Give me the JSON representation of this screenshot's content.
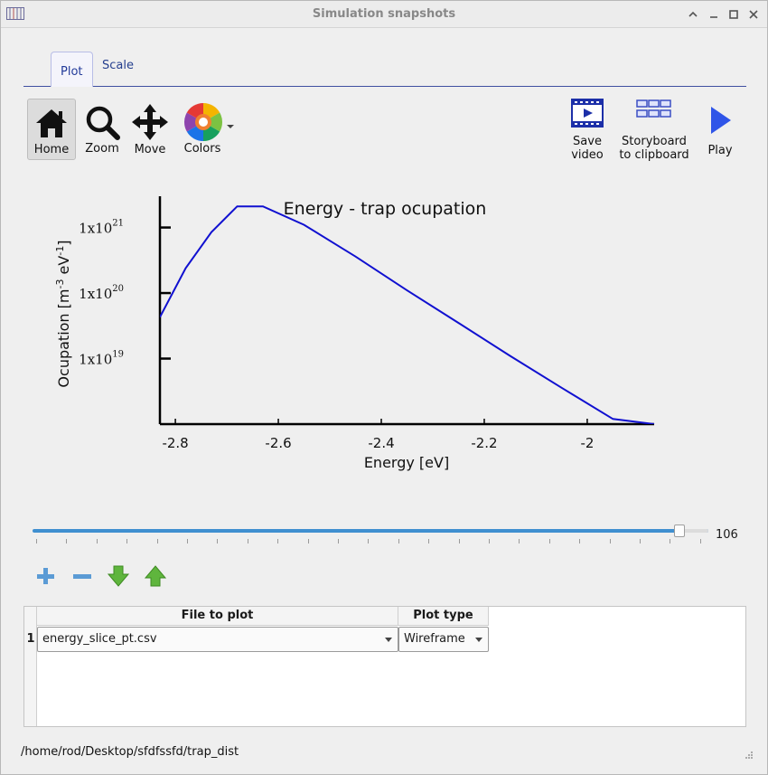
{
  "window": {
    "title": "Simulation snapshots"
  },
  "tabs": [
    {
      "label": "Plot"
    },
    {
      "label": "Scale"
    }
  ],
  "toolbar": {
    "home": "Home",
    "zoom": "Zoom",
    "move": "Move",
    "colors": "Colors",
    "save_video": [
      "Save",
      "video"
    ],
    "storyboard": [
      "Storyboard",
      "to clipboard"
    ],
    "play": "Play"
  },
  "chart_data": {
    "type": "line",
    "title": "Energy - trap ocupation",
    "xlabel": "Energy [eV]",
    "ylabel_parts": {
      "main": "Ocupation [m",
      "exp1": "-3",
      "mid": " eV",
      "exp2": "-1",
      "end": "]"
    },
    "yscale": "log",
    "xlim": [
      -2.83,
      -1.87
    ],
    "ylim": [
      1e+18,
      3e+21
    ],
    "x_ticks": [
      "-2.8",
      "-2.6",
      "-2.4",
      "-2.2",
      "-2"
    ],
    "x_tick_values": [
      -2.8,
      -2.6,
      -2.4,
      -2.2,
      -2.0
    ],
    "y_ticks": [
      {
        "base": "1x10",
        "exp": "21",
        "value": 1e+21
      },
      {
        "base": "1x10",
        "exp": "20",
        "value": 1e+20
      },
      {
        "base": "1x10",
        "exp": "19",
        "value": 1e+19
      }
    ],
    "series": [
      {
        "color": "#1010d0",
        "x": [
          -2.83,
          -2.78,
          -2.73,
          -2.68,
          -2.63,
          -2.55,
          -2.45,
          -2.35,
          -2.25,
          -2.15,
          -2.05,
          -1.95,
          -1.87
        ],
        "y": [
          4.3e+19,
          2.4e+20,
          8.5e+20,
          2.1e+21,
          2.1e+21,
          1.1e+21,
          3.6e+20,
          1.1e+20,
          3.5e+19,
          1.1e+19,
          3.6e+18,
          1.2e+18,
          4.5e+17
        ]
      }
    ]
  },
  "slider": {
    "value": "106",
    "fraction": 0.92
  },
  "table": {
    "headers": [
      "File to plot",
      "Plot type"
    ],
    "rows": [
      {
        "num": "1",
        "file": "energy_slice_pt.csv",
        "type": "Wireframe"
      }
    ]
  },
  "status": {
    "path": "/home/rod/Desktop/sfdfssfd/trap_dist"
  }
}
